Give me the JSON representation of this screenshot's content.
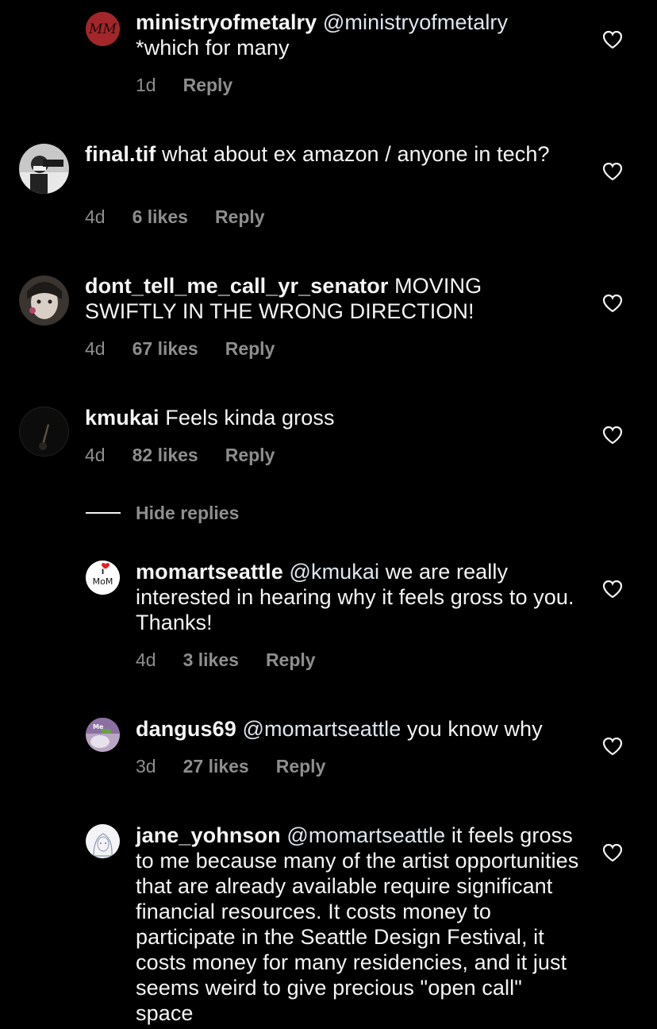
{
  "comments": [
    {
      "username": "ministryofmetalry",
      "mention": "@ministryofmetalry",
      "text": "*which for many",
      "time": "1d",
      "likes": "",
      "reply_label": "Reply"
    },
    {
      "username": "final.tif",
      "mention": "",
      "text": "what about ex amazon / anyone in tech?",
      "time": "4d",
      "likes": "6 likes",
      "reply_label": "Reply"
    },
    {
      "username": "dont_tell_me_call_yr_senator",
      "mention": "",
      "text": "MOVING SWIFTLY IN THE WRONG DIRECTION!",
      "time": "4d",
      "likes": "67 likes",
      "reply_label": "Reply"
    },
    {
      "username": "kmukai",
      "mention": "",
      "text": "Feels kinda gross",
      "time": "4d",
      "likes": "82 likes",
      "reply_label": "Reply"
    },
    {
      "username": "momartseattle",
      "mention": "@kmukai",
      "text": "we are really interested in hearing why it feels gross to you. Thanks!",
      "time": "4d",
      "likes": "3 likes",
      "reply_label": "Reply",
      "avatar_text": "MoM"
    },
    {
      "username": "dangus69",
      "mention": "@momartseattle",
      "text": "you know why",
      "time": "3d",
      "likes": "27 likes",
      "reply_label": "Reply",
      "avatar_text": "Me"
    },
    {
      "username": "jane_yohnson",
      "mention": "@momartseattle",
      "text": "it feels gross to me because many of the artist opportunities that are already available require significant financial resources. It costs money to participate in the Seattle Design Festival, it costs money for many residencies, and it just seems weird to give precious \"open call\" space"
    }
  ],
  "hide_replies_label": "Hide replies",
  "icons": {
    "like": "heart-outline-icon",
    "logo_glyph": "heart-icon"
  },
  "colors": {
    "background": "#000000",
    "text": "#f5f5f5",
    "muted": "#8e8e8e",
    "logo_heart": "#e0202a"
  }
}
